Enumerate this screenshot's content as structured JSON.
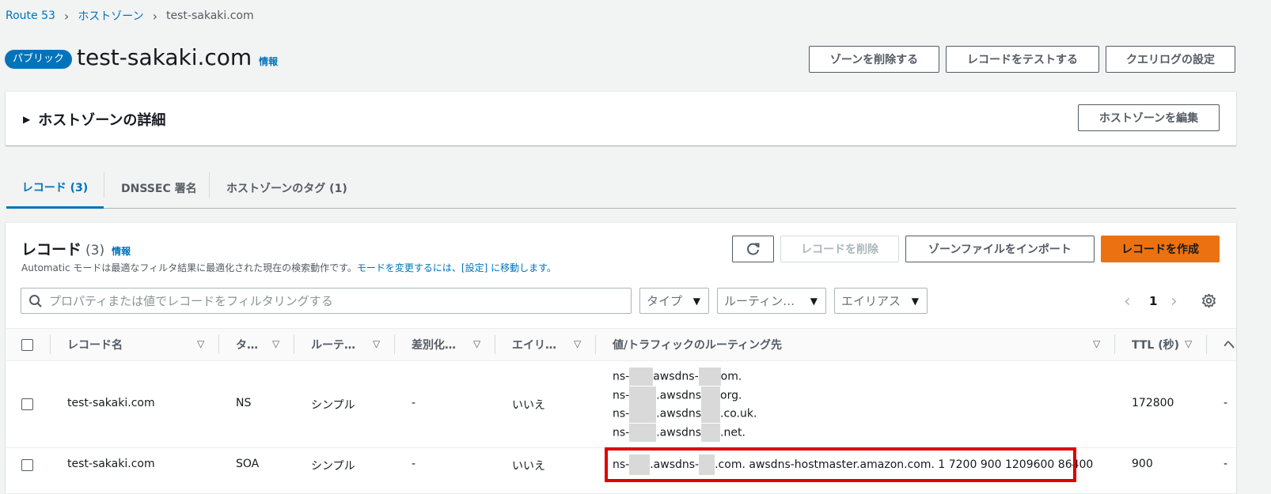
{
  "breadcrumb": {
    "items": [
      "Route 53",
      "ホストゾーン",
      "test-sakaki.com"
    ]
  },
  "header": {
    "badge": "パブリック",
    "title": "test-sakaki.com",
    "info": "情報",
    "buttons": {
      "delete_zone": "ゾーンを削除する",
      "test_record": "レコードをテストする",
      "query_log": "クエリログの設定"
    }
  },
  "details": {
    "title": "ホストゾーンの詳細",
    "edit_button": "ホストゾーンを編集"
  },
  "tabs": [
    {
      "label": "レコード (3)"
    },
    {
      "label": "DNSSEC 署名"
    },
    {
      "label": "ホストゾーンのタグ (1)"
    }
  ],
  "records": {
    "heading": "レコード",
    "count": "(3)",
    "info": "情報",
    "description": "Automatic モードは最適なフィルタ結果に最適化された現在の検索動作です。",
    "description_link": "モードを変更するには、[設定] に移動します。",
    "buttons": {
      "delete": "レコードを削除",
      "import": "ゾーンファイルをインポート",
      "create": "レコードを作成"
    },
    "search_placeholder": "プロパティまたは値でレコードをフィルタリングする",
    "filters": {
      "type": "タイプ",
      "routing": "ルーティン…",
      "alias": "エイリアス"
    },
    "pagination": {
      "page": "1"
    },
    "columns": {
      "name": "レコード名",
      "type": "タ…",
      "routing": "ルーテ…",
      "diff": "差別化…",
      "alias": "エイリ…",
      "value": "値/トラフィックのルーティング先",
      "ttl": "TTL (秒)",
      "extra": "ヘ"
    },
    "rows": [
      {
        "name": "test-sakaki.com",
        "type": "NS",
        "routing": "シンプル",
        "diff": "-",
        "alias": "いいえ",
        "values": [
          {
            "a": "ns-",
            "b": "awsdns-",
            "c": "om."
          },
          {
            "a": "ns-",
            "b": ".awsdns",
            "c": "org."
          },
          {
            "a": "ns-",
            "b": ".awsdns",
            "c": ".co.uk."
          },
          {
            "a": "ns-",
            "b": ".awsdns",
            "c": ".net."
          }
        ],
        "ttl": "172800",
        "extra": "-"
      },
      {
        "name": "test-sakaki.com",
        "type": "SOA",
        "routing": "シンプル",
        "diff": "-",
        "alias": "いいえ",
        "value_a": "ns-",
        "value_b": ".awsdns-",
        "value_c": ".com. awsdns-hostmaster.amazon.com. 1 7200 900 1209600 86400",
        "ttl": "900",
        "extra": "-"
      }
    ]
  },
  "colors": {
    "link": "#0073bb",
    "primary": "#ec7211",
    "highlight": "#e00000"
  }
}
